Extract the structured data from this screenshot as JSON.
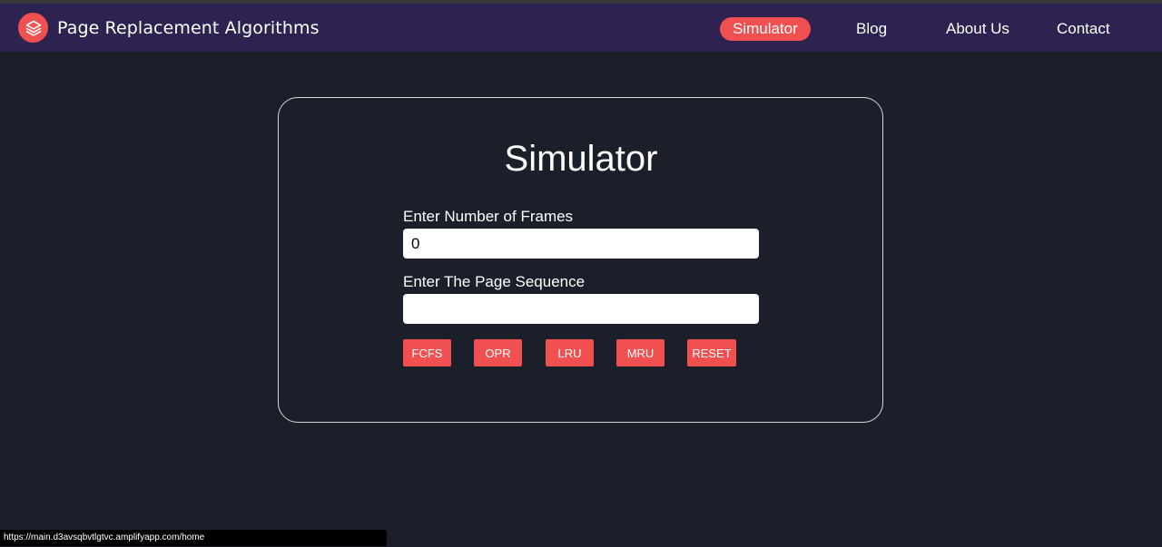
{
  "nav": {
    "brand": "Page Replacement Algorithms",
    "logo_icon": "layers-icon",
    "items": [
      {
        "label": "Simulator",
        "active": true
      },
      {
        "label": "Blog",
        "active": false
      },
      {
        "label": "About Us",
        "active": false
      },
      {
        "label": "Contact",
        "active": false
      }
    ]
  },
  "simulator": {
    "title": "Simulator",
    "frames_label": "Enter Number of Frames",
    "frames_value": "0",
    "sequence_label": "Enter The Page Sequence",
    "sequence_value": "",
    "buttons": [
      "FCFS",
      "OPR",
      "LRU",
      "MRU",
      "RESET"
    ]
  },
  "status_bar": {
    "url": "https://main.d3avsqbvtlgtvc.amplifyapp.com/home"
  },
  "colors": {
    "background": "#1b1f2a",
    "navbar": "#2e2350",
    "accent": "#f0504f"
  }
}
